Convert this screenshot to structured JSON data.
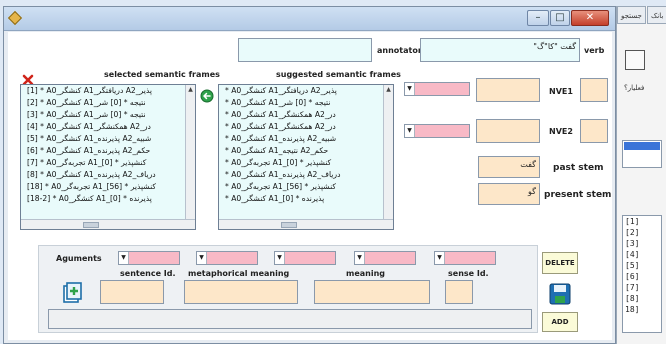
{
  "background_window": {
    "tabs": [
      "جستجو",
      "بانک"
    ],
    "side_label": "فعلیار؟",
    "list_items": [
      "[1]",
      "[2]",
      "[3]",
      "[4]",
      "[5]",
      "[6]",
      "[7]",
      "[8]",
      "18]"
    ]
  },
  "window": {
    "caption_buttons": [
      "–",
      "□",
      "✕"
    ]
  },
  "annotator": {
    "label": "annotator",
    "value": ""
  },
  "verb": {
    "label": "verb",
    "value": "گفت \"كا\"گ\""
  },
  "selected_frames": {
    "title": "selected semantic frames",
    "items": [
      "[1] * A0_کنشگر A1_دریافتگر A2_پذیر",
      "[2] * A0_کنشگر A1_نتیجه * [0] شر",
      "[3] * A0_کنشگر A1_نتیجه * [0] شر",
      "[4] * A0_کنشگر A1_همکنشگر A2_در",
      "[5] * A0_کنشگر A1_پذیرنده A2_شبیه",
      "[6] * A0_کنشگر A1_پذیرنده A2_حکم",
      "[7] * A0_تجربه‌گر A1_کنشپذیر * [0]",
      "[8] * A0_کنشگر A1_پذیرنده A2_دریاف",
      "[18] * A0_تجربه‌گر A1_کنشپذیر * [56]",
      "[18-2] * A0_کنشگر A1_پذیرنده * [0]"
    ]
  },
  "suggested_frames": {
    "title": "suggested semantic frames",
    "items": [
      "* A0_کنشگر A1_دریافتگر A2_پذیر",
      "* A0_کنشگر A1_نتیجه * [0] شر",
      "* A0_کنشگر A1_همکنشگر A2_در",
      "* A0_کنشگر A1_همکنشگر A2_در",
      "* A0_کنشگر A1_پذیرنده A2_شبیه",
      "* A0_کنشگر A1_نتیجه A2_حکم",
      "* A0_تجربه‌گر A1_کنشپذیر * [0]",
      "* A0_کنشگر A1_پذیرنده A2_دریاف",
      "* A0_تجربه‌گر A1_کنشپذیر * [56]",
      "* A0_کنشگر A1_پذیرنده * [0]"
    ]
  },
  "nve1": {
    "label": "NVE1",
    "value": ""
  },
  "nve2": {
    "label": "NVE2",
    "value": ""
  },
  "past_stem": {
    "label": "past stem",
    "value": "گفت"
  },
  "present_stem": {
    "label": "present stem",
    "value": "گو"
  },
  "arguments": {
    "label": "Aguments"
  },
  "sentence_id": {
    "label": "sentence Id.",
    "value": ""
  },
  "metaphorical_meaning": {
    "label": "metaphorical meaning",
    "value": ""
  },
  "meaning": {
    "label": "meaning",
    "value": ""
  },
  "sense_id": {
    "label": "sense Id.",
    "value": ""
  },
  "buttons": {
    "delete": "DELETE",
    "add": "ADD"
  },
  "colors": {
    "cyan_field": "#e9fbfb",
    "peach_field": "#fde7c9",
    "pink_field": "#f8b9c6",
    "button_yellow": "#fbfbd8"
  }
}
